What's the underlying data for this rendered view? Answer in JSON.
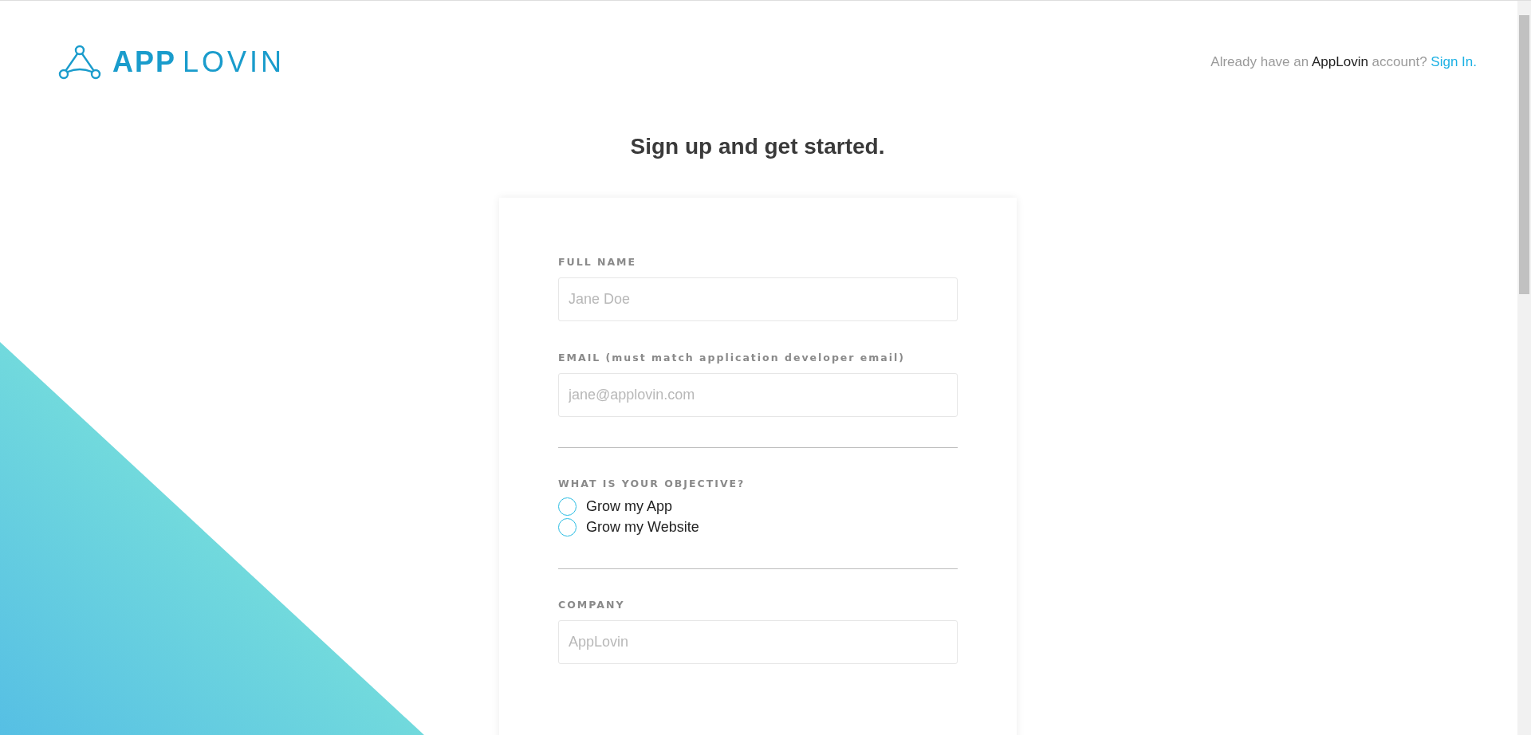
{
  "logo": {
    "bold": "APP",
    "light": "LOVIN"
  },
  "signin": {
    "before": "Already have an",
    "brand": "AppLovin",
    "after": "account?",
    "link": "Sign In."
  },
  "heading": "Sign up and get started.",
  "form": {
    "fields": [
      {
        "label": "FULL NAME",
        "placeholder": "Jane Doe"
      },
      {
        "label": "EMAIL (must match application developer email)",
        "placeholder": "jane@applovin.com"
      }
    ],
    "objective": {
      "label": "WHAT IS YOUR OBJECTIVE?",
      "options": [
        {
          "label": "Grow my App",
          "selected": false
        },
        {
          "label": "Grow my Website",
          "selected": false
        }
      ]
    },
    "company": {
      "label": "COMPANY",
      "placeholder": "AppLovin"
    }
  }
}
